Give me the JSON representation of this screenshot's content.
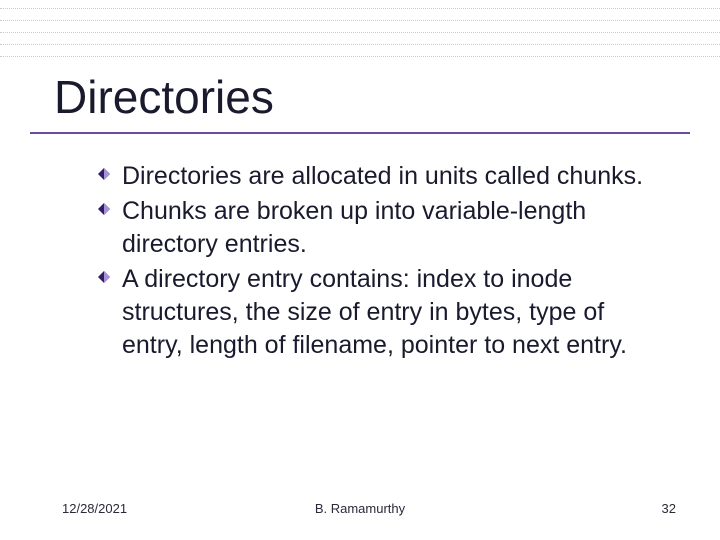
{
  "title": "Directories",
  "bullets": [
    "Directories are allocated in units called chunks.",
    "Chunks are broken up into variable-length directory entries.",
    "A directory entry contains: index to inode structures, the size of entry in bytes, type of entry, length of filename, pointer to next entry."
  ],
  "footer": {
    "date": "12/28/2021",
    "author": "B. Ramamurthy",
    "page": "32"
  },
  "colors": {
    "accent": "#6a4ca0",
    "bullet_dark": "#2e2060",
    "bullet_light": "#a890d8"
  }
}
